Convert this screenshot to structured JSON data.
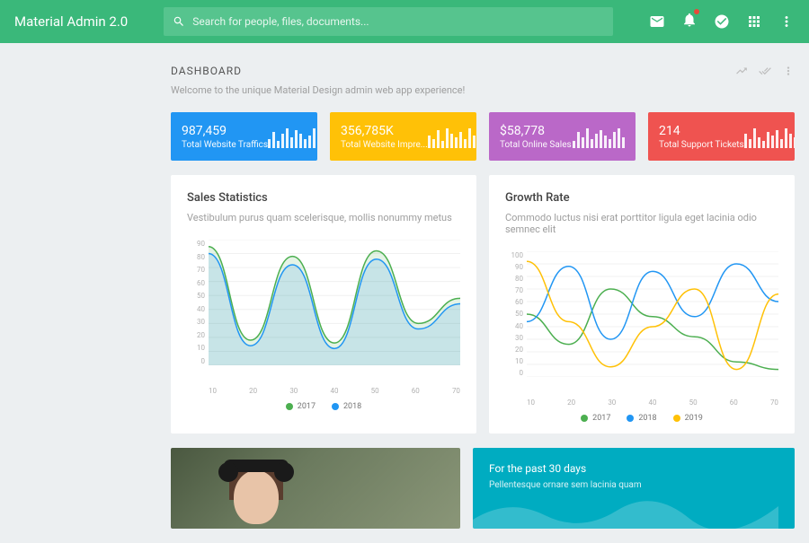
{
  "header": {
    "brand": "Material Admin 2.0",
    "search_placeholder": "Search for people, files, documents..."
  },
  "dashboard": {
    "title": "DASHBOARD",
    "subtitle": "Welcome to the unique Material Design admin web app experience!"
  },
  "stats": [
    {
      "value": "987,459",
      "label": "Total Website Traffics",
      "color": "#2196f3",
      "bars": [
        10,
        18,
        8,
        16,
        22,
        12,
        20,
        16,
        10,
        14,
        22,
        18
      ]
    },
    {
      "value": "356,785K",
      "label": "Total Website Impre...",
      "color": "#ffc107",
      "bars": [
        14,
        10,
        20,
        8,
        22,
        16,
        12,
        18,
        10,
        22,
        14,
        18
      ]
    },
    {
      "value": "$58,778",
      "label": "Total Online Sales",
      "color": "#ba68c8",
      "bars": [
        8,
        18,
        12,
        22,
        10,
        16,
        20,
        14,
        10,
        18,
        22,
        12
      ]
    },
    {
      "value": "214",
      "label": "Total Support Tickets",
      "color": "#ef5350",
      "bars": [
        16,
        10,
        22,
        12,
        8,
        18,
        14,
        20,
        10,
        22,
        16,
        12
      ]
    }
  ],
  "sales": {
    "title": "Sales Statistics",
    "desc": "Vestibulum purus quam scelerisque, mollis nonummy metus",
    "legend": [
      {
        "label": "2017",
        "color": "#4caf50"
      },
      {
        "label": "2018",
        "color": "#2196f3"
      }
    ]
  },
  "growth": {
    "title": "Growth Rate",
    "desc": "Commodo luctus nisi erat porttitor ligula eget lacinia odio semnec elit",
    "legend": [
      {
        "label": "2017",
        "color": "#4caf50"
      },
      {
        "label": "2018",
        "color": "#2196f3"
      },
      {
        "label": "2019",
        "color": "#ffc107"
      }
    ]
  },
  "teal": {
    "title": "For the past 30 days",
    "desc": "Pellentesque ornare sem lacinia quam"
  },
  "chart_data": [
    {
      "type": "area",
      "title": "Sales Statistics",
      "xlabel": "",
      "ylabel": "",
      "ylim": [
        0,
        90
      ],
      "x": [
        10,
        20,
        30,
        40,
        50,
        60,
        70
      ],
      "yticks": [
        0,
        10,
        20,
        30,
        40,
        50,
        60,
        70,
        80,
        90
      ],
      "series": [
        {
          "name": "2017",
          "color": "#4caf50",
          "values": [
            85,
            18,
            78,
            16,
            82,
            30,
            48
          ]
        },
        {
          "name": "2018",
          "color": "#2196f3",
          "values": [
            80,
            14,
            72,
            12,
            76,
            26,
            44
          ]
        }
      ]
    },
    {
      "type": "line",
      "title": "Growth Rate",
      "xlabel": "",
      "ylabel": "",
      "ylim": [
        0,
        100
      ],
      "x": [
        10,
        20,
        30,
        40,
        50,
        60,
        70
      ],
      "yticks": [
        0,
        10,
        20,
        30,
        40,
        50,
        60,
        70,
        80,
        90,
        100
      ],
      "series": [
        {
          "name": "2017",
          "color": "#4caf50",
          "values": [
            50,
            26,
            70,
            48,
            32,
            12,
            6
          ]
        },
        {
          "name": "2018",
          "color": "#2196f3",
          "values": [
            44,
            88,
            30,
            84,
            48,
            90,
            60
          ]
        },
        {
          "name": "2019",
          "color": "#ffc107",
          "values": [
            92,
            44,
            8,
            40,
            70,
            6,
            66
          ]
        }
      ]
    }
  ]
}
